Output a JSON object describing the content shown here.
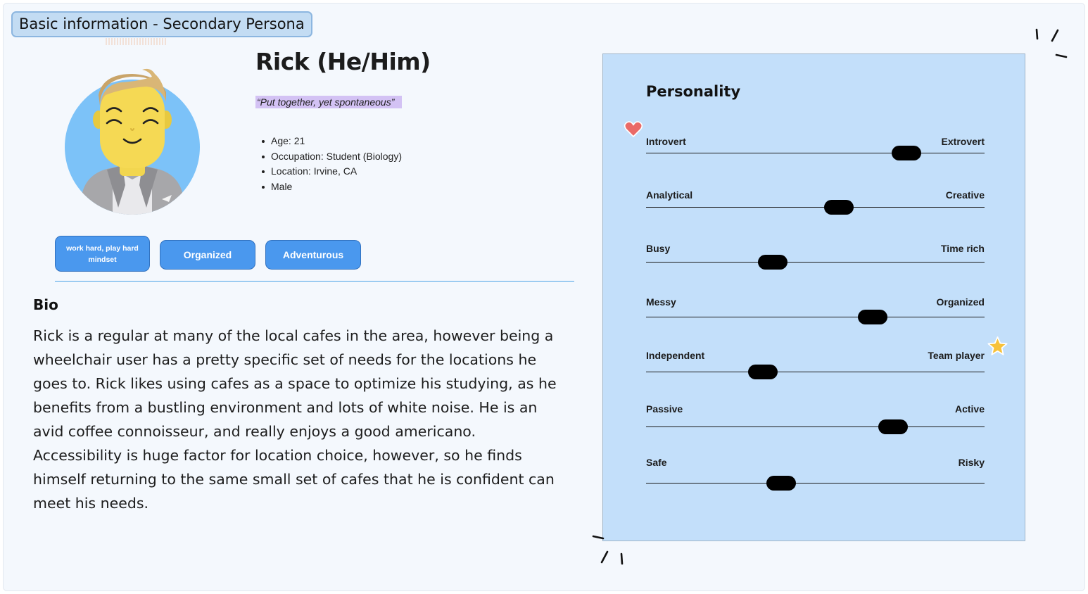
{
  "section_label": "Basic information - Secondary Persona",
  "persona": {
    "name": "Rick (He/Him)",
    "quote": "“Put together, yet spontaneous”",
    "facts": [
      "Age: 21",
      "Occupation: Student (Biology)",
      "Location: Irvine, CA",
      "Male"
    ]
  },
  "tags": [
    {
      "line1": "work hard, play hard",
      "line2": "mindset"
    },
    {
      "label": "Organized"
    },
    {
      "label": "Adventurous"
    }
  ],
  "bio": {
    "heading": "Bio",
    "lines": [
      "Rick is a regular at many of the local cafes in the area, however being a",
      "wheelchair user has a pretty specific set of needs for the locations he",
      "goes to. Rick likes using cafes as a space to optimize his studying, as he",
      "benefits from a bustling environment and lots of white noise. He is an",
      "avid coffee connoisseur, and really enjoys a good americano.",
      "Accessibility is  huge factor for location choice, however, so he finds",
      "himself returning to the same small set of cafes that he is confident can",
      "meet his needs."
    ]
  },
  "personality": {
    "title": "Personality",
    "traits": [
      {
        "left": "Introvert",
        "right": "Extrovert",
        "value": 0.77
      },
      {
        "left": "Analytical",
        "right": "Creative",
        "value": 0.57
      },
      {
        "left": "Busy",
        "right": "Time rich",
        "value": 0.375
      },
      {
        "left": "Messy",
        "right": "Organized",
        "value": 0.67
      },
      {
        "left": "Independent",
        "right": "Team player",
        "value": 0.345
      },
      {
        "left": "Passive",
        "right": "Active",
        "value": 0.73
      },
      {
        "left": "Safe",
        "right": "Risky",
        "value": 0.4
      }
    ]
  },
  "colors": {
    "canvas": "#f4f8fd",
    "tag_fill": "#c3dcf3",
    "chip": "#4a98ee",
    "quote_highlight": "#d3c2f4",
    "personality_card": "#c3dffa",
    "heart": "#ea6a67",
    "star": "#f7c23b"
  },
  "icons": [
    "avatar-illustration",
    "heart-icon",
    "star-icon",
    "sparkle-mark"
  ]
}
